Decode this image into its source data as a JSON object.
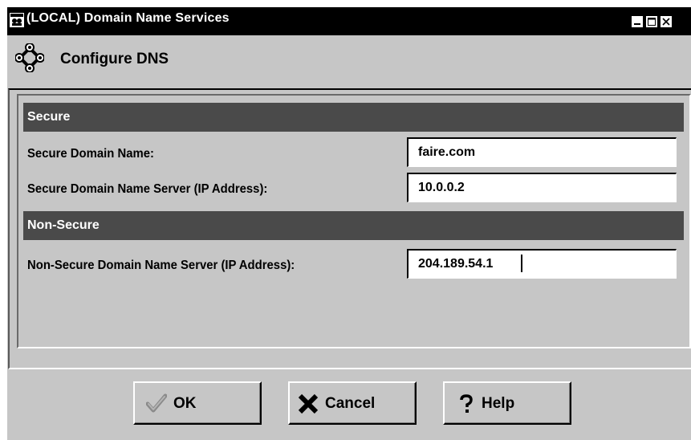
{
  "window": {
    "title": "(LOCAL) Domain Name Services",
    "controls": [
      "minimize",
      "maximize",
      "close"
    ]
  },
  "header": {
    "title": "Configure DNS",
    "icon": "network-icon"
  },
  "sections": [
    {
      "label": "Secure",
      "fields": [
        {
          "label": "Secure Domain Name:",
          "value": "faire.com"
        },
        {
          "label": "Secure Domain Name Server (IP Address):",
          "value": "10.0.0.2"
        }
      ]
    },
    {
      "label": "Non-Secure",
      "fields": [
        {
          "label": "Non-Secure Domain Name Server (IP Address):",
          "value": "204.189.54.1"
        }
      ]
    }
  ],
  "buttons": {
    "ok": "OK",
    "cancel": "Cancel",
    "help": "Help"
  },
  "colors": {
    "titlebar": "#000000",
    "section_bar": "#4a4a4a",
    "window_bg": "#c6c6c6"
  }
}
